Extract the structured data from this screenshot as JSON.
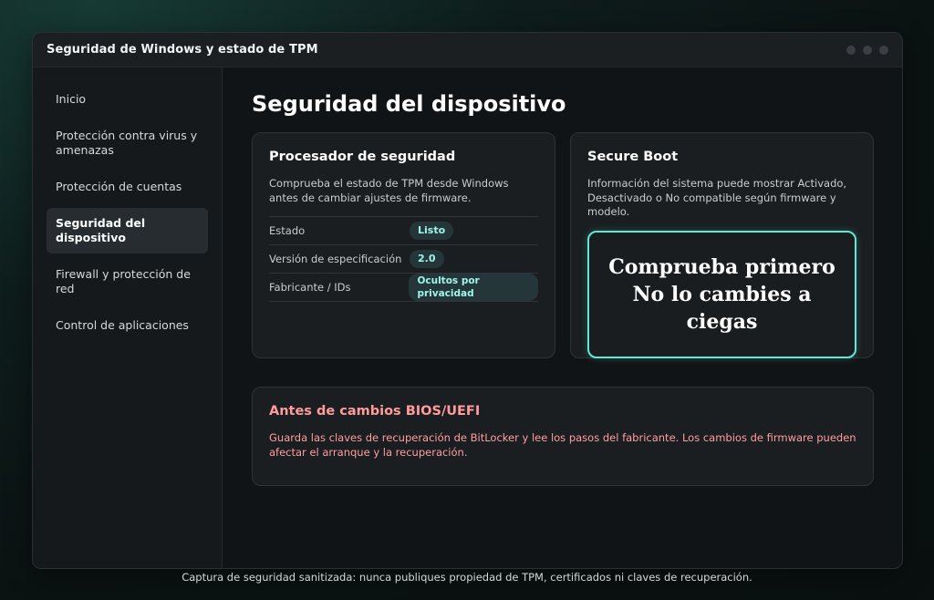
{
  "window": {
    "title": "Seguridad de Windows y estado de TPM"
  },
  "sidebar": {
    "items": [
      {
        "label": "Inicio"
      },
      {
        "label": "Protección contra virus y amenazas"
      },
      {
        "label": "Protección de cuentas"
      },
      {
        "label": "Seguridad del dispositivo",
        "active": true
      },
      {
        "label": "Firewall y protección de red"
      },
      {
        "label": "Control de aplicaciones"
      }
    ]
  },
  "main": {
    "title": "Seguridad del dispositivo",
    "tpm_card": {
      "title": "Procesador de seguridad",
      "description": "Comprueba el estado de TPM desde Windows antes de cambiar ajustes de firmware.",
      "rows": [
        {
          "label": "Estado",
          "value": "Listo"
        },
        {
          "label": "Versión de especificación",
          "value": "2.0"
        },
        {
          "label": "Fabricante / IDs",
          "value": "Ocultos por privacidad"
        }
      ]
    },
    "secure_boot_card": {
      "title": "Secure Boot",
      "description": "Información del sistema puede mostrar Activado, Desactivado o No compatible según firmware y modelo.",
      "callout": "Comprueba primero No lo cambies a ciegas"
    },
    "bios_card": {
      "title": "Antes de cambios BIOS/UEFI",
      "description": "Guarda las claves de recuperación de BitLocker y lee los pasos del fabricante. Los cambios de firmware pueden afectar el arranque y la recuperación."
    }
  },
  "footer": {
    "text": "Captura de seguridad sanitizada: nunca publiques propiedad de TPM, certificados ni claves de recuperación."
  },
  "colors": {
    "accent": "#5fe8d6",
    "pill_text": "#9ff5ea",
    "warning": "#ff9b9b"
  }
}
